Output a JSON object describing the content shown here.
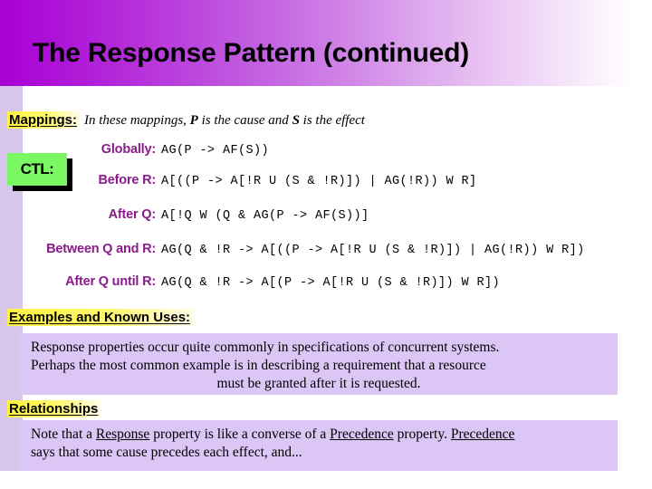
{
  "slide": {
    "title": "The Response Pattern (continued)",
    "theme": {
      "header_gradient_start": "#a800d4",
      "header_gradient_end": "#ffffff",
      "left_strip": "#d6c6ec",
      "label_purple": "#8c1a8c",
      "highlight_yellow": "#fff33f",
      "callout_green": "#7cf764",
      "body_box_lavender": "#dcc6f5",
      "text_black": "#000000"
    }
  },
  "mappings": {
    "label": "Mappings:",
    "note_prefix": "In these mappings, ",
    "cause_symbol": "P",
    "note_middle": " is the cause and ",
    "effect_symbol": "S",
    "note_suffix": " is the effect",
    "callout": {
      "label": "CTL:"
    },
    "rows": [
      {
        "label": "Globally:",
        "formula": "AG(P -> AF(S))"
      },
      {
        "label": "Before R:",
        "formula": "A[((P -> A[!R U (S & !R)]) | AG(!R)) W R]"
      },
      {
        "label": "After Q:",
        "formula": "A[!Q W (Q & AG(P -> AF(S))]"
      },
      {
        "label": "Between Q and R:",
        "formula": "AG(Q & !R -> A[((P -> A[!R U (S & !R)]) | AG(!R)) W R])"
      },
      {
        "label": "After Q until R:",
        "formula": "AG(Q & !R -> A[(P -> A[!R U (S & !R)]) W R])"
      }
    ]
  },
  "examples": {
    "heading": "Examples and Known Uses:",
    "lines": [
      "Response properties occur quite commonly in specifications of concurrent systems.",
      "Perhaps the most common example is in describing a requirement that a resource",
      "must be granted after it is requested."
    ]
  },
  "relationships": {
    "heading": "Relationships",
    "line1_a": "Note that a ",
    "line1_link1": "Response",
    "line1_b": " property is like a converse of a ",
    "line1_link2": "Precedence",
    "line1_c": " property. ",
    "line1_link3": "Precedence",
    "line2": "says that some cause precedes each effect, and..."
  }
}
